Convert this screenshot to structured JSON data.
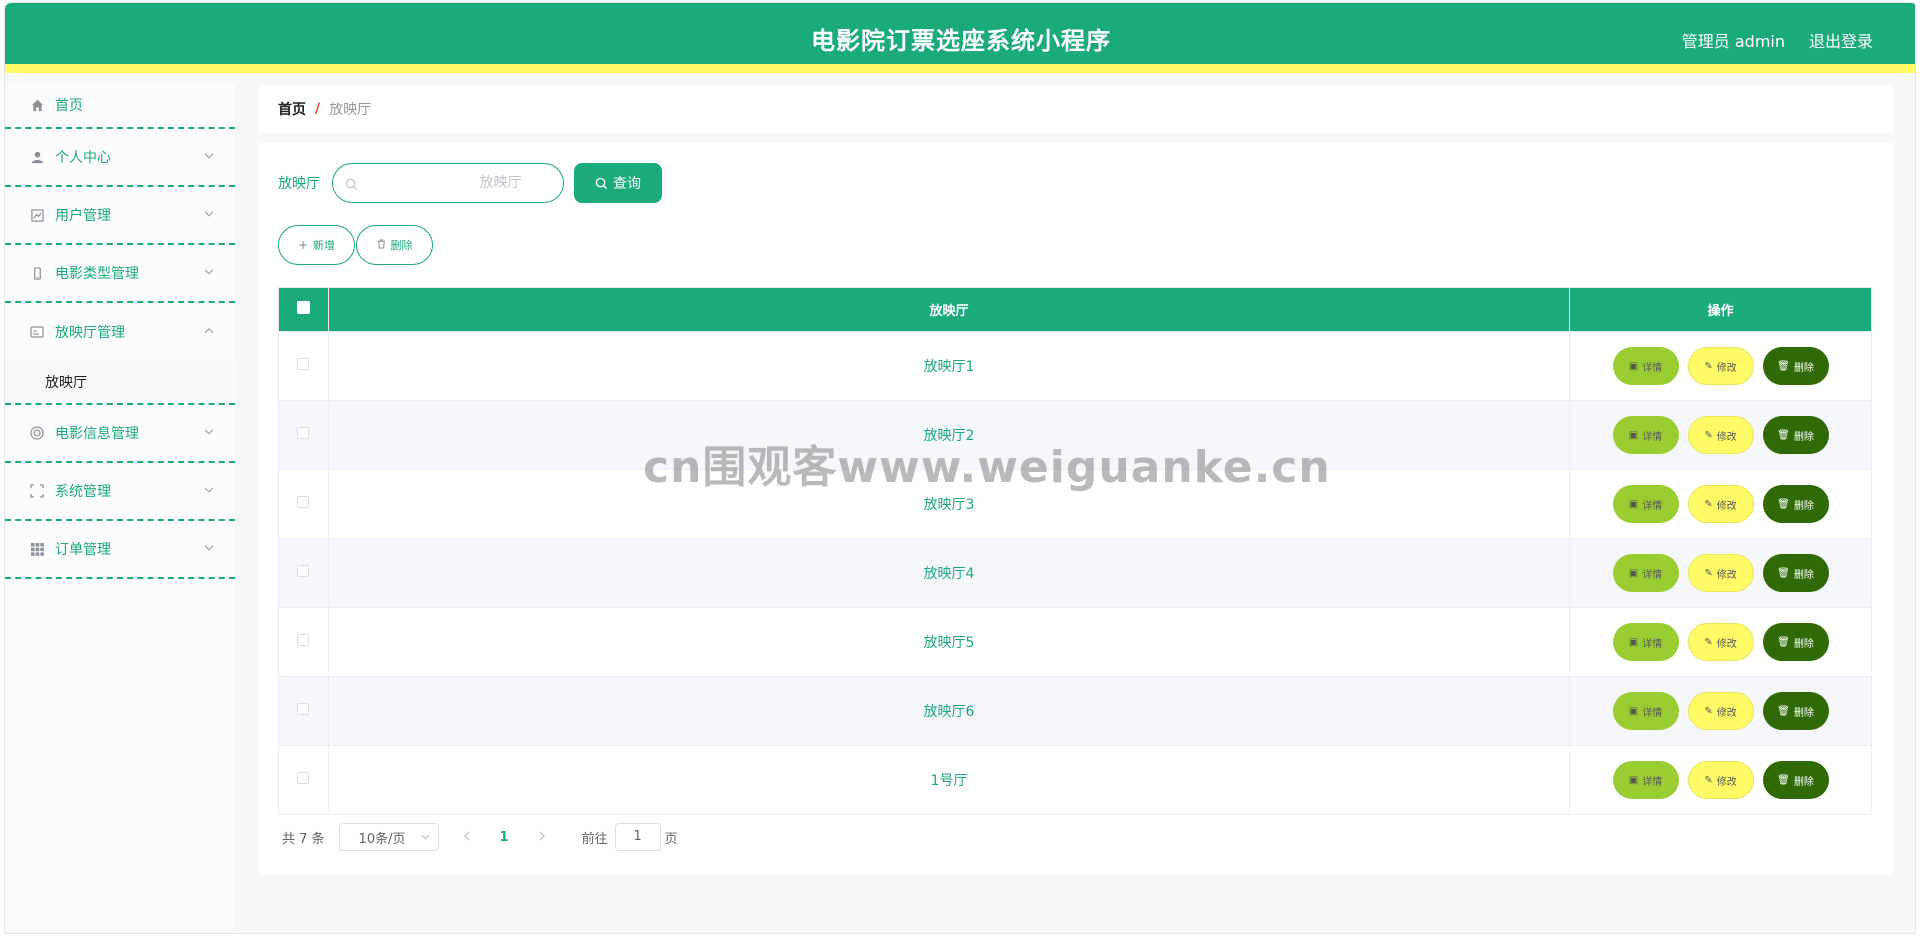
{
  "header": {
    "title": "电影院订票选座系统小程序",
    "user": "管理员 admin",
    "logout": "退出登录"
  },
  "sidebar": {
    "items": [
      {
        "label": "首页",
        "icon": "home-icon"
      },
      {
        "label": "个人中心",
        "icon": "user-icon"
      },
      {
        "label": "用户管理",
        "icon": "chart-icon"
      },
      {
        "label": "电影类型管理",
        "icon": "phone-icon"
      },
      {
        "label": "放映厅管理",
        "icon": "card-icon",
        "sub": "放映厅"
      },
      {
        "label": "电影信息管理",
        "icon": "target-icon"
      },
      {
        "label": "系统管理",
        "icon": "frame-icon"
      },
      {
        "label": "订单管理",
        "icon": "grid-icon"
      }
    ]
  },
  "breadcrumb": {
    "home": "首页",
    "sep": "/",
    "current": "放映厅"
  },
  "search": {
    "label": "放映厅",
    "placeholder": "放映厅",
    "button": "查询"
  },
  "actions": {
    "add": "新增",
    "delete": "删除"
  },
  "table": {
    "headers": [
      "放映厅",
      "操作"
    ],
    "rows": [
      "放映厅1",
      "放映厅2",
      "放映厅3",
      "放映厅4",
      "放映厅5",
      "放映厅6",
      "1号厅"
    ],
    "ops": {
      "detail": "详情",
      "edit": "修改",
      "delete": "删除"
    }
  },
  "pager": {
    "total": "共 7 条",
    "size": "10条/页",
    "page": "1",
    "goto": "前往",
    "goto_value": "1",
    "unit": "页"
  },
  "watermark": "cn围观客www.weiguanke.cn",
  "colors": {
    "primary": "#1baa7a",
    "accent_yellow": "#fffb66",
    "detail": "#9acd32",
    "delete": "#2f6a07"
  }
}
